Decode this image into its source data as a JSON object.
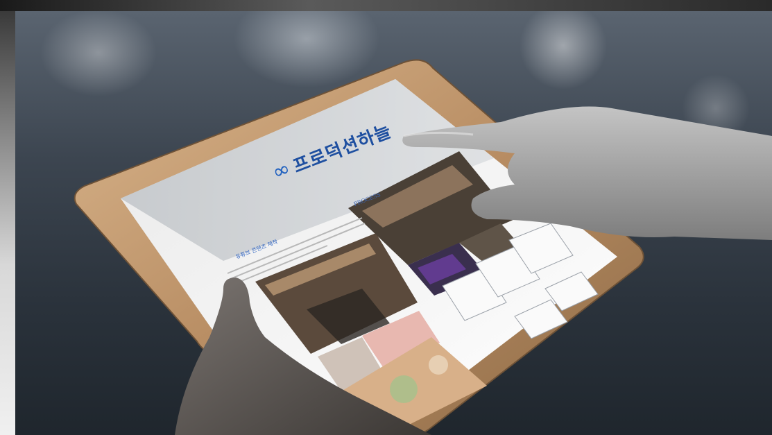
{
  "tablet_screen": {
    "logo": {
      "brand_text": "프로덕션하늘",
      "mark": "infinity-logo-icon"
    },
    "process_label": "PROCESS",
    "section_label": "유튜브 콘텐츠 제작"
  },
  "colors": {
    "brand_blue": "#1e4fa0",
    "tablet_frame": "#c7a27a",
    "background_dark": "#2a323b"
  }
}
